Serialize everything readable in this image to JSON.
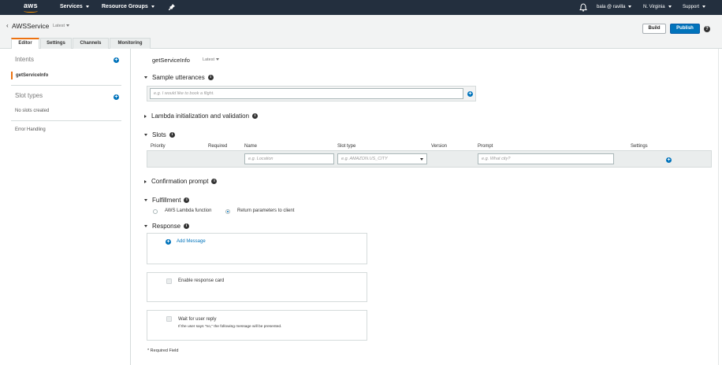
{
  "topbar": {
    "logo_text": "aws",
    "services": "Services",
    "resource_groups": "Resource Groups",
    "user": "bala @ ravilla",
    "region": "N. Virginia",
    "support": "Support"
  },
  "header": {
    "back": "‹",
    "title": "AWSService",
    "version": "Latest",
    "tabs": [
      "Editor",
      "Settings",
      "Channels",
      "Monitoring"
    ],
    "build": "Build",
    "publish": "Publish",
    "help": "?"
  },
  "sidebar": {
    "intents_label": "Intents",
    "intent_item": "getServiceInfo",
    "slot_types_label": "Slot types",
    "no_slots": "No slots created",
    "error_handling": "Error Handling",
    "plus": "+"
  },
  "main": {
    "intent_name": "getServiceInfo",
    "intent_version": "Latest",
    "info": "i",
    "plus": "+",
    "sample_utterances": "Sample utterances",
    "utterance_placeholder": "e.g. I would like to book a flight.",
    "lambda_init": "Lambda initialization and validation",
    "slots": "Slots",
    "slot_headers": [
      "Priority",
      "Required",
      "Name",
      "Slot type",
      "Version",
      "Prompt",
      "Settings"
    ],
    "slot_name_placeholder": "e.g. Location",
    "slot_type_placeholder": "e.g. AMAZON.US_CITY",
    "slot_prompt_placeholder": "e.g. What city?",
    "confirmation_prompt": "Confirmation prompt",
    "fulfillment": "Fulfillment",
    "fulfillment_options": [
      "AWS Lambda function",
      "Return parameters to client"
    ],
    "fulfillment_selected": "Return parameters to client",
    "response": "Response",
    "add_message": "Add Message",
    "enable_response_card": "Enable response card",
    "wait_for_reply": "Wait for user reply",
    "wait_note": "If the user says \"no,\" the following message will be presented.",
    "required_field": "* Required Field"
  },
  "colors": {
    "topbar": "#232f3e",
    "accent_orange": "#ec7211",
    "primary_blue": "#0073bb"
  }
}
